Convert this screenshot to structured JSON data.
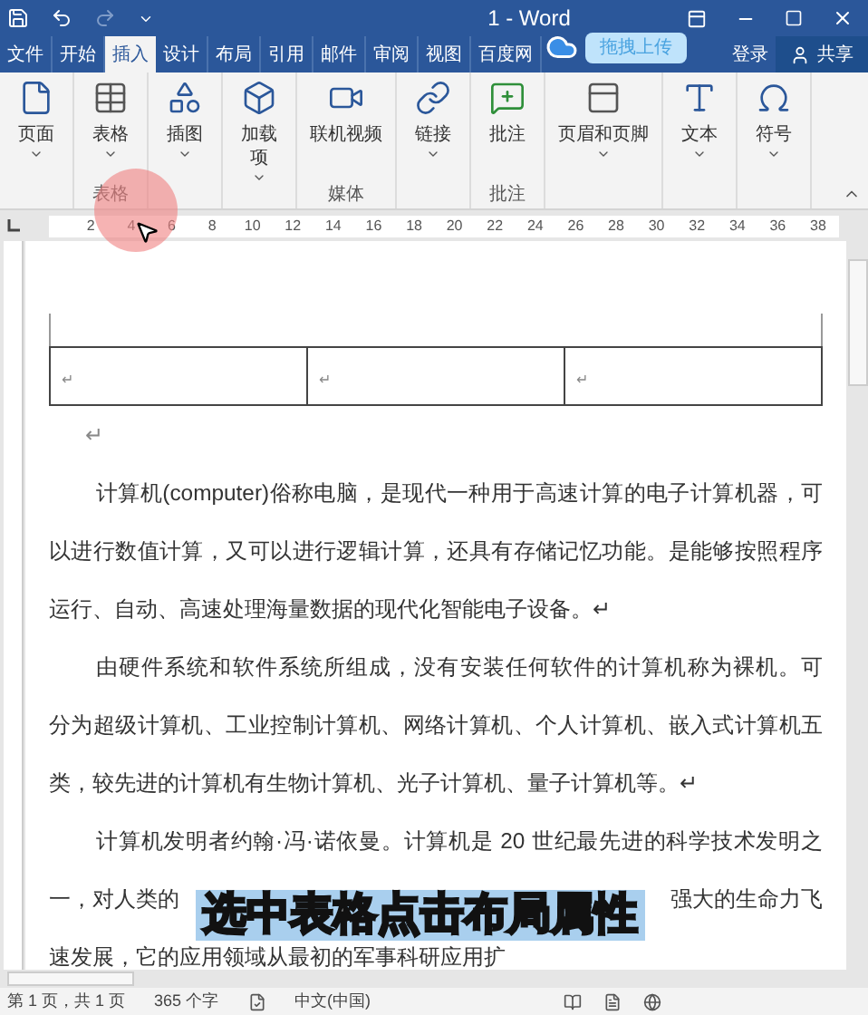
{
  "window": {
    "title": "1 - Word"
  },
  "quick_access": [
    {
      "kind": "save",
      "disabled": false
    },
    {
      "kind": "undo",
      "disabled": false
    },
    {
      "kind": "redo",
      "disabled": true
    },
    {
      "kind": "customize",
      "disabled": false
    }
  ],
  "tabs": [
    {
      "label": "文件",
      "selected": false
    },
    {
      "label": "开始",
      "selected": false
    },
    {
      "label": "插入",
      "selected": true
    },
    {
      "label": "设计",
      "selected": false
    },
    {
      "label": "布局",
      "selected": false
    },
    {
      "label": "引用",
      "selected": false
    },
    {
      "label": "邮件",
      "selected": false
    },
    {
      "label": "审阅",
      "selected": false
    },
    {
      "label": "视图",
      "selected": false
    },
    {
      "label": "百度网",
      "selected": false
    }
  ],
  "cloud_popup": {
    "label": "拖拽上传"
  },
  "account": {
    "sign_in": "登录",
    "share": "共享"
  },
  "ribbon": {
    "groups": [
      {
        "buttons": [
          {
            "kind": "page",
            "label": "页面",
            "dropdown": true
          }
        ]
      },
      {
        "label": "表格",
        "buttons": [
          {
            "kind": "table",
            "label": "表格",
            "dropdown": true
          }
        ]
      },
      {
        "buttons": [
          {
            "kind": "shapes",
            "label": "插图",
            "dropdown": true
          }
        ]
      },
      {
        "buttons": [
          {
            "kind": "addin",
            "label": "加载项",
            "dropdown": true
          }
        ]
      },
      {
        "label": "媒体",
        "buttons": [
          {
            "kind": "video",
            "label": "联机视频",
            "dropdown": false
          }
        ]
      },
      {
        "buttons": [
          {
            "kind": "link",
            "label": "链接",
            "dropdown": true
          }
        ]
      },
      {
        "label": "批注",
        "buttons": [
          {
            "kind": "comment",
            "label": "批注",
            "dropdown": false
          }
        ]
      },
      {
        "buttons": [
          {
            "kind": "header",
            "label": "页眉和页脚",
            "dropdown": true
          }
        ]
      },
      {
        "buttons": [
          {
            "kind": "text",
            "label": "文本",
            "dropdown": true
          }
        ]
      },
      {
        "buttons": [
          {
            "kind": "symbol",
            "label": "符号",
            "dropdown": true
          }
        ]
      }
    ]
  },
  "ruler": {
    "ticks": [
      "2",
      "4",
      "6",
      "8",
      "10",
      "12",
      "14",
      "16",
      "18",
      "20",
      "22",
      "24",
      "26",
      "28",
      "30",
      "32",
      "34",
      "36",
      "38"
    ]
  },
  "document": {
    "table": {
      "rows": [
        [
          "↵",
          "↵",
          "↵"
        ]
      ]
    },
    "paragraphs": [
      {
        "lines": [
          {
            "segments": [
              "↵"
            ]
          }
        ]
      },
      {
        "lines": [
          {
            "segments": [
              "计算机(computer)俗称电脑，是现代一种用于高速计算的电子计算机器，可"
            ]
          },
          {
            "segments": [
              "以进行数值计算，又可以进行逻辑计算，还具有存储记忆功能。是能够按照程序"
            ]
          },
          {
            "segments": [
              "运行、自动、高速处理海量数据的现代化智能电子设备。↵"
            ]
          }
        ]
      },
      {
        "lines": [
          {
            "segments": [
              "由硬件系统和软件系统所组成，没有安装任何软件的计算机称为裸机。可"
            ]
          },
          {
            "segments": [
              "分为超级计算机、工业控制计算机、网络计算机、个人计算机、嵌入式计算机五"
            ]
          },
          {
            "segments": [
              "类，较先进的计算机有生物计算机、光子计算机、量子计算机等。↵"
            ]
          }
        ]
      },
      {
        "lines": [
          {
            "segments": [
              "计算机发明者约翰·冯·诺依曼。计算机是 20 世纪最先进的科学技术发明之"
            ]
          },
          {
            "segments": [
              "一，对人类的",
              "强大的生命力飞"
            ]
          },
          {
            "segments": [
              "速发展，它的应用领域从最初的军事科研应用扩"
            ]
          }
        ]
      }
    ]
  },
  "subtitle": "选中表格点击布局属性",
  "status_bar": {
    "page": "第 1 页，共 1 页",
    "words": "365 个字",
    "language": "中文(中国)"
  }
}
